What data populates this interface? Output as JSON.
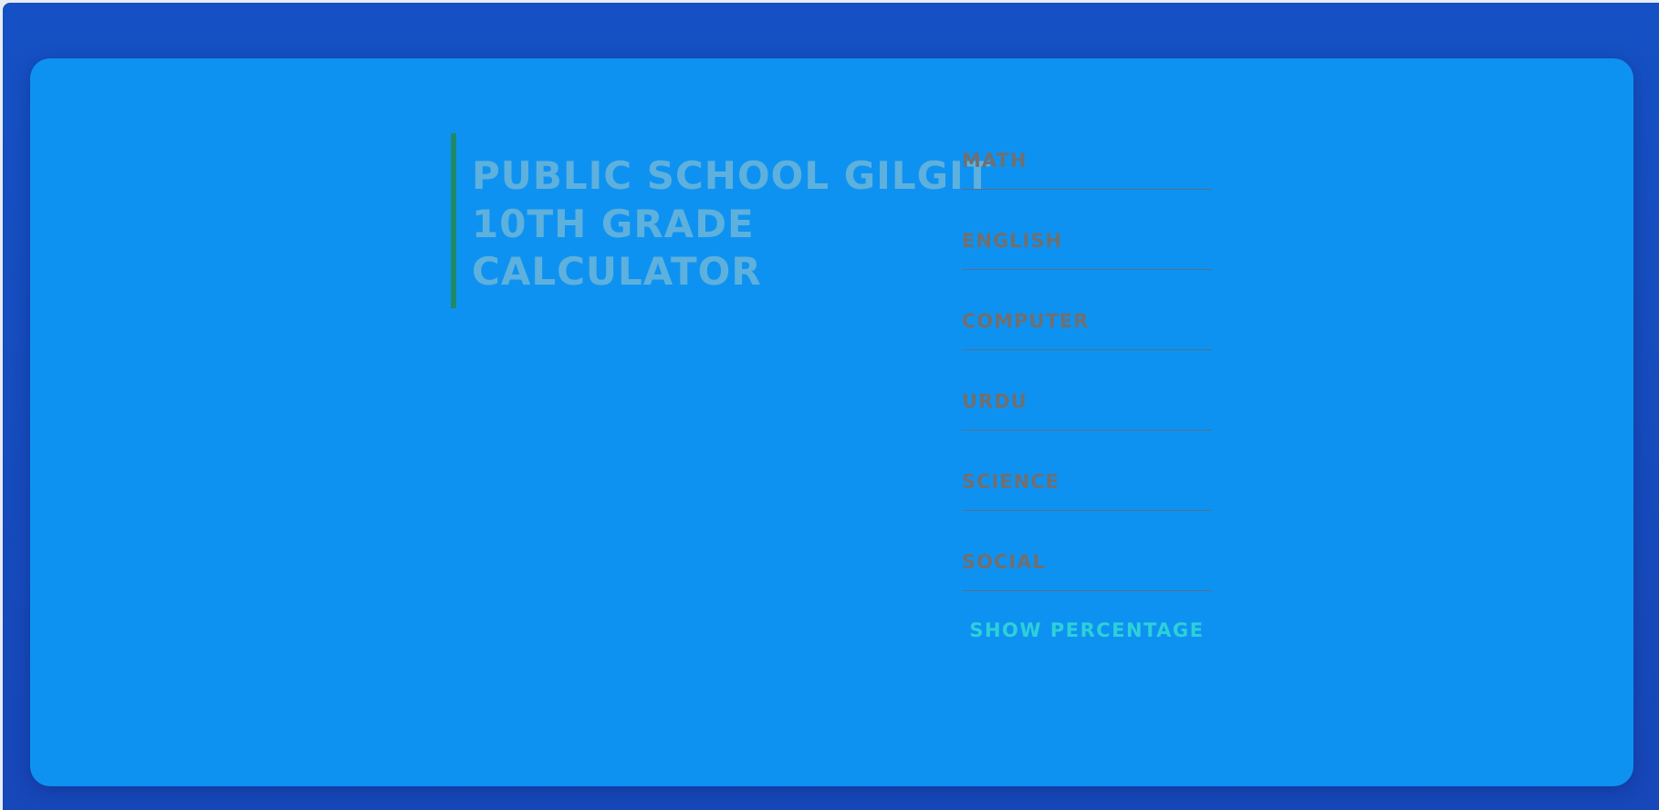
{
  "header": {
    "title_lines": [
      "PUBLIC SCHOOL GILGIT",
      "10TH GRADE",
      "CALCULATOR"
    ]
  },
  "form": {
    "fields": [
      {
        "placeholder": "MATH",
        "value": ""
      },
      {
        "placeholder": "ENGLISH",
        "value": ""
      },
      {
        "placeholder": "COMPUTER",
        "value": ""
      },
      {
        "placeholder": "URDU",
        "value": ""
      },
      {
        "placeholder": "SCIENCE",
        "value": ""
      },
      {
        "placeholder": "SOCIAL",
        "value": ""
      }
    ],
    "submit_label": "SHOW PERCENTAGE"
  },
  "colors": {
    "outer_background": "#1551c4",
    "card_background": "#0e92f1",
    "accent_bar": "#1f8a67",
    "title_text": "#5eb1dd",
    "placeholder_text": "#716f6f",
    "button_text": "#2ed0d8"
  }
}
